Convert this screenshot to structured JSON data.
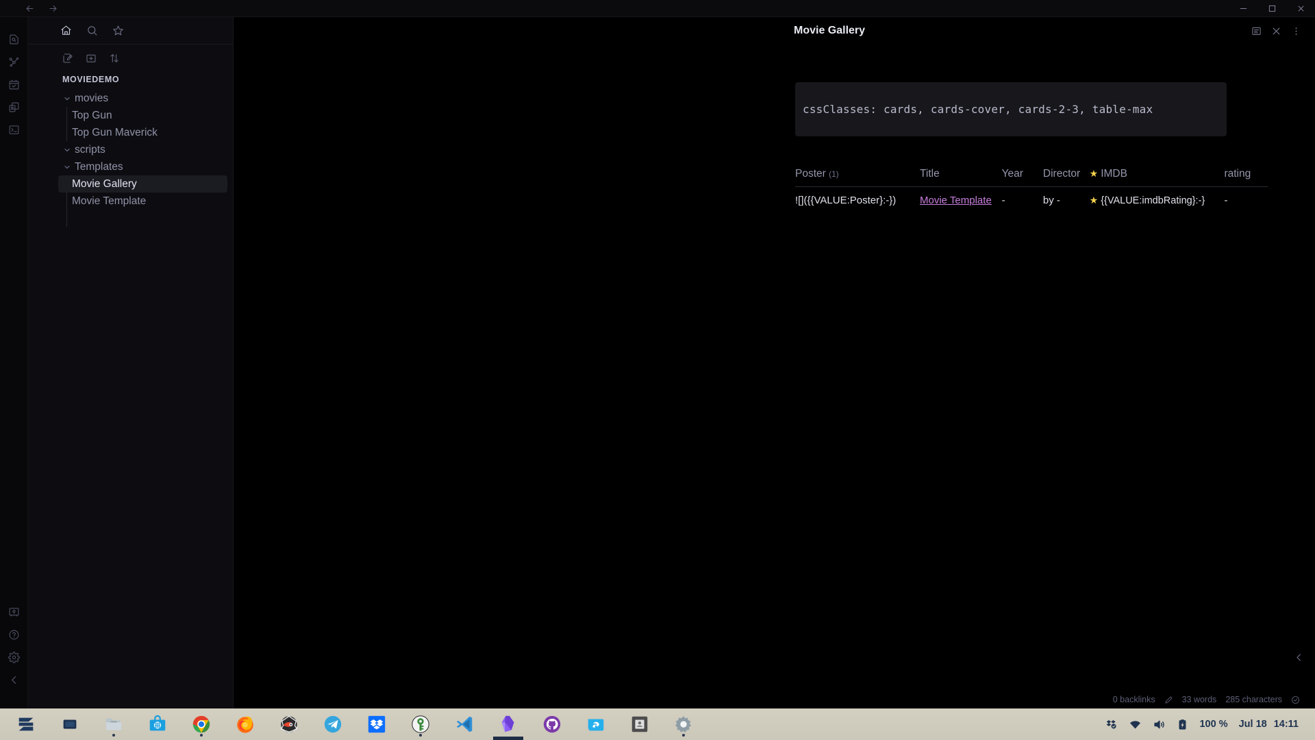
{
  "window": {
    "nav": {
      "back": "←",
      "forward": "→"
    },
    "controls": [
      {
        "name": "minimize-button",
        "glyph": "minimize"
      },
      {
        "name": "maximize-button",
        "glyph": "maximize"
      },
      {
        "name": "close-button",
        "glyph": "close"
      }
    ]
  },
  "ribbon": {
    "top_items": [
      {
        "name": "quick-switcher-icon",
        "label": "Quick switcher"
      },
      {
        "name": "graph-view-icon",
        "label": "Graph view"
      },
      {
        "name": "daily-note-icon",
        "label": "Daily note"
      },
      {
        "name": "canvas-icon",
        "label": "Canvas"
      },
      {
        "name": "terminal-icon",
        "label": "Terminal"
      }
    ],
    "bottom_items": [
      {
        "name": "vault-switcher-icon",
        "label": "Open another vault"
      },
      {
        "name": "help-icon",
        "label": "Help"
      },
      {
        "name": "settings-icon",
        "label": "Settings"
      },
      {
        "name": "collapse-sidebar-icon",
        "label": "Collapse sidebar"
      }
    ]
  },
  "file_pane": {
    "tabs": [
      {
        "name": "files-tab",
        "icon": "home-icon",
        "active": true
      },
      {
        "name": "search-tab",
        "icon": "search-icon",
        "active": false
      },
      {
        "name": "bookmarks-tab",
        "icon": "star-icon",
        "active": false
      }
    ],
    "toolbar": [
      {
        "name": "new-note-button",
        "icon": "pencil-square-icon"
      },
      {
        "name": "new-folder-button",
        "icon": "folder-plus-icon"
      },
      {
        "name": "sort-button",
        "icon": "sort-arrows-icon"
      }
    ],
    "vault_name": "MOVIEDEMO",
    "tree": [
      {
        "label": "movies",
        "type": "folder",
        "expanded": true,
        "depth": 0,
        "selected": false
      },
      {
        "label": "Top Gun",
        "type": "file",
        "depth": 1,
        "selected": false
      },
      {
        "label": "Top Gun Maverick",
        "type": "file",
        "depth": 1,
        "selected": false
      },
      {
        "label": "scripts",
        "type": "folder",
        "expanded": true,
        "depth": 0,
        "selected": false
      },
      {
        "label": "Templates",
        "type": "folder",
        "expanded": true,
        "depth": 0,
        "selected": false
      },
      {
        "label": "Movie Gallery",
        "type": "file",
        "depth": 1,
        "selected": true
      },
      {
        "label": "Movie Template",
        "type": "file",
        "depth": 1,
        "selected": false
      }
    ]
  },
  "editor": {
    "title": "Movie Gallery",
    "actions": [
      {
        "name": "reading-view-button",
        "icon": "document-icon"
      },
      {
        "name": "close-tab-button",
        "icon": "close-icon"
      },
      {
        "name": "more-options-button",
        "icon": "kebab-menu-icon"
      }
    ],
    "frontmatter": "cssClasses: cards, cards-cover, cards-2-3, table-max",
    "table": {
      "headers": [
        {
          "label": "Poster",
          "count": "(1)"
        },
        {
          "label": "Title",
          "count": ""
        },
        {
          "label": "Year",
          "count": ""
        },
        {
          "label": "Director",
          "count": ""
        },
        {
          "label": "IMDB",
          "count": "",
          "star": true
        },
        {
          "label": "rating",
          "count": ""
        }
      ],
      "rows": [
        {
          "poster": "![]({{VALUE:Poster}:-})",
          "title": "Movie Template",
          "year": "-",
          "director": "by -",
          "imdb": "{{VALUE:imdbRating}:-}",
          "imdb_star": true,
          "rating": "-"
        }
      ]
    }
  },
  "status_bar": {
    "backlinks": "0 backlinks",
    "words": "33 words",
    "characters": "285 characters",
    "pencil_icon": "pencil-icon",
    "check_icon": "check-circle-icon",
    "collapse_icon": "chevron-left-icon"
  },
  "taskbar": {
    "apps": [
      {
        "name": "zorin-menu",
        "icon": "zorin",
        "running": false
      },
      {
        "name": "show-desktop",
        "icon": "windows-stack",
        "running": false
      },
      {
        "name": "file-manager",
        "icon": "folder",
        "running": true
      },
      {
        "name": "software-store",
        "icon": "store",
        "running": false
      },
      {
        "name": "google-chrome",
        "icon": "chrome",
        "running": true
      },
      {
        "name": "firefox",
        "icon": "firefox",
        "running": false
      },
      {
        "name": "blender",
        "icon": "blender",
        "running": false
      },
      {
        "name": "telegram",
        "icon": "telegram",
        "running": false
      },
      {
        "name": "dropbox",
        "icon": "dropbox",
        "running": false
      },
      {
        "name": "keepassxc",
        "icon": "keepassxc",
        "running": true
      },
      {
        "name": "vs-code",
        "icon": "vscode",
        "running": false
      },
      {
        "name": "obsidian",
        "icon": "obsidian",
        "running": true,
        "active": true
      },
      {
        "name": "github-desktop",
        "icon": "github",
        "running": false
      },
      {
        "name": "sublime-text",
        "icon": "sublime",
        "running": false
      },
      {
        "name": "archive-manager",
        "icon": "archive",
        "running": false
      },
      {
        "name": "settings",
        "icon": "gear",
        "running": true
      }
    ],
    "tray": {
      "sync_label": "sync-status-icon",
      "wifi_label": "wifi-icon",
      "volume_label": "volume-icon",
      "battery_label": "battery-icon",
      "battery_percent": "100 %",
      "date": "Jul 18",
      "time": "14:11"
    }
  }
}
